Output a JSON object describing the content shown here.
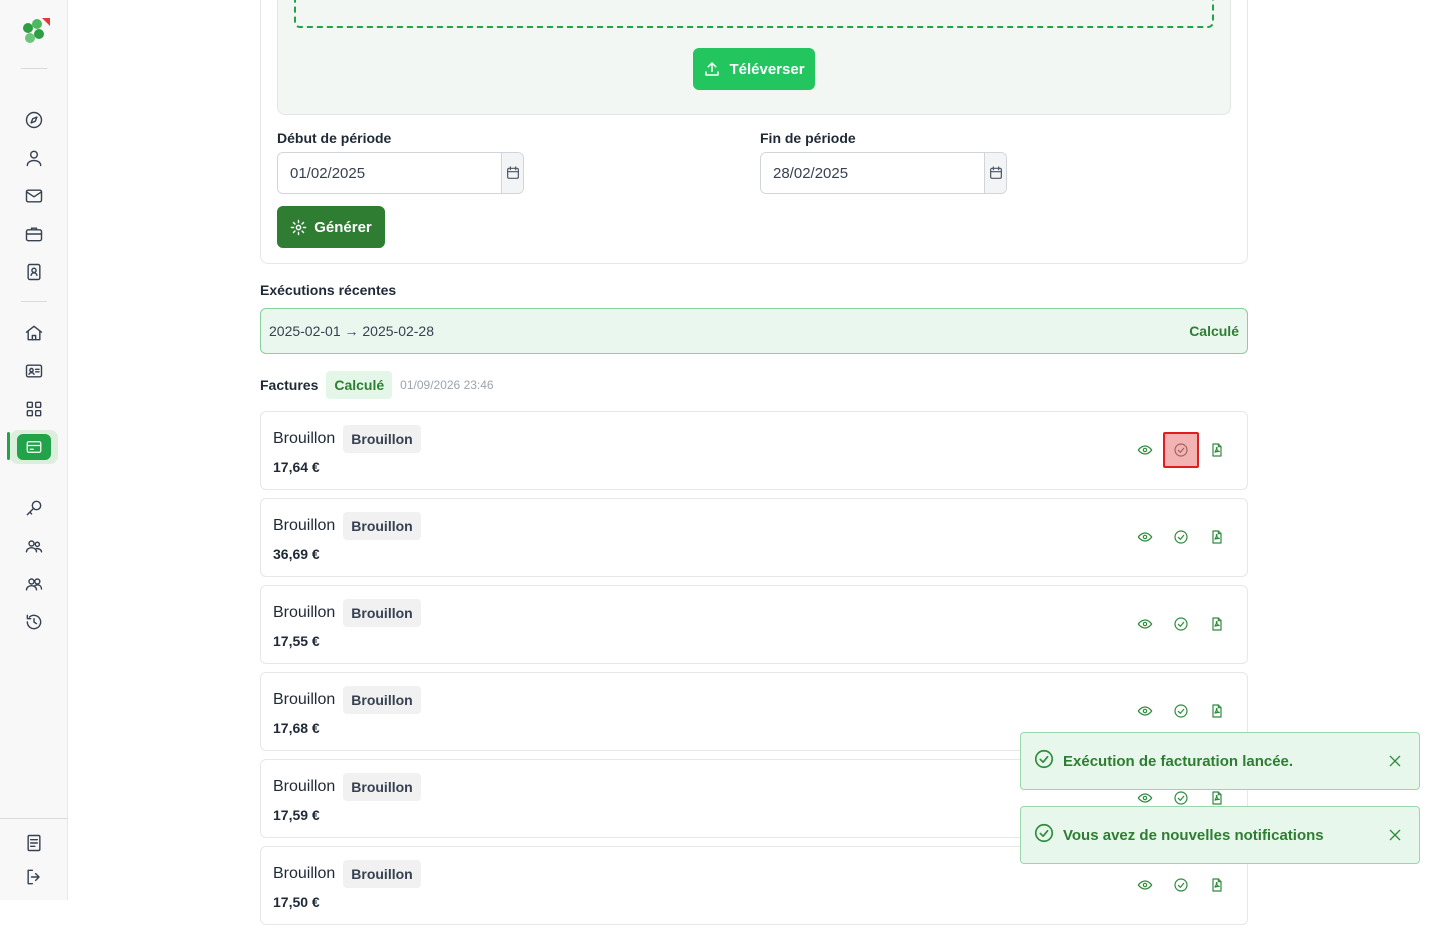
{
  "colors": {
    "accent": "#22c55e",
    "primary_dark": "#2e7d32",
    "success_bg": "#e8f7ec",
    "highlight_border": "#e11d1d"
  },
  "sidebar": {
    "logo": "clover-logo",
    "items": [
      {
        "icon": "compass-icon"
      },
      {
        "icon": "user-icon"
      },
      {
        "icon": "mail-icon"
      },
      {
        "icon": "briefcase-icon"
      },
      {
        "icon": "contact-book-icon"
      },
      {
        "icon": "home-icon"
      },
      {
        "icon": "id-card-icon"
      },
      {
        "icon": "grid-icon"
      },
      {
        "icon": "billing-card-icon",
        "active": true
      },
      {
        "icon": "key-icon"
      },
      {
        "icon": "users-icon"
      },
      {
        "icon": "group-icon"
      },
      {
        "icon": "history-icon"
      },
      {
        "icon": "document-icon"
      },
      {
        "icon": "logout-icon"
      }
    ]
  },
  "upload": {
    "button_label": "Téléverser"
  },
  "period": {
    "start_label": "Début de période",
    "start_value": "01/02/2025",
    "end_label": "Fin de période",
    "end_value": "28/02/2025"
  },
  "generate": {
    "button_label": "Générer"
  },
  "recent_runs": {
    "title": "Exécutions récentes",
    "items": [
      {
        "range": "2025-02-01 → 2025-02-28",
        "status": "Calculé"
      }
    ]
  },
  "invoices": {
    "title": "Factures",
    "status": "Calculé",
    "timestamp": "01/09/2026 23:46",
    "items": [
      {
        "name": "Brouillon",
        "badge": "Brouillon",
        "amount": "17,64 €"
      },
      {
        "name": "Brouillon",
        "badge": "Brouillon",
        "amount": "36,69 €"
      },
      {
        "name": "Brouillon",
        "badge": "Brouillon",
        "amount": "17,55 €"
      },
      {
        "name": "Brouillon",
        "badge": "Brouillon",
        "amount": "17,68 €"
      },
      {
        "name": "Brouillon",
        "badge": "Brouillon",
        "amount": "17,59 €"
      },
      {
        "name": "Brouillon",
        "badge": "Brouillon",
        "amount": "17,50 €"
      }
    ]
  },
  "toasts": [
    {
      "message": "Exécution de facturation lancée."
    },
    {
      "message": "Vous avez de nouvelles notifications"
    }
  ]
}
